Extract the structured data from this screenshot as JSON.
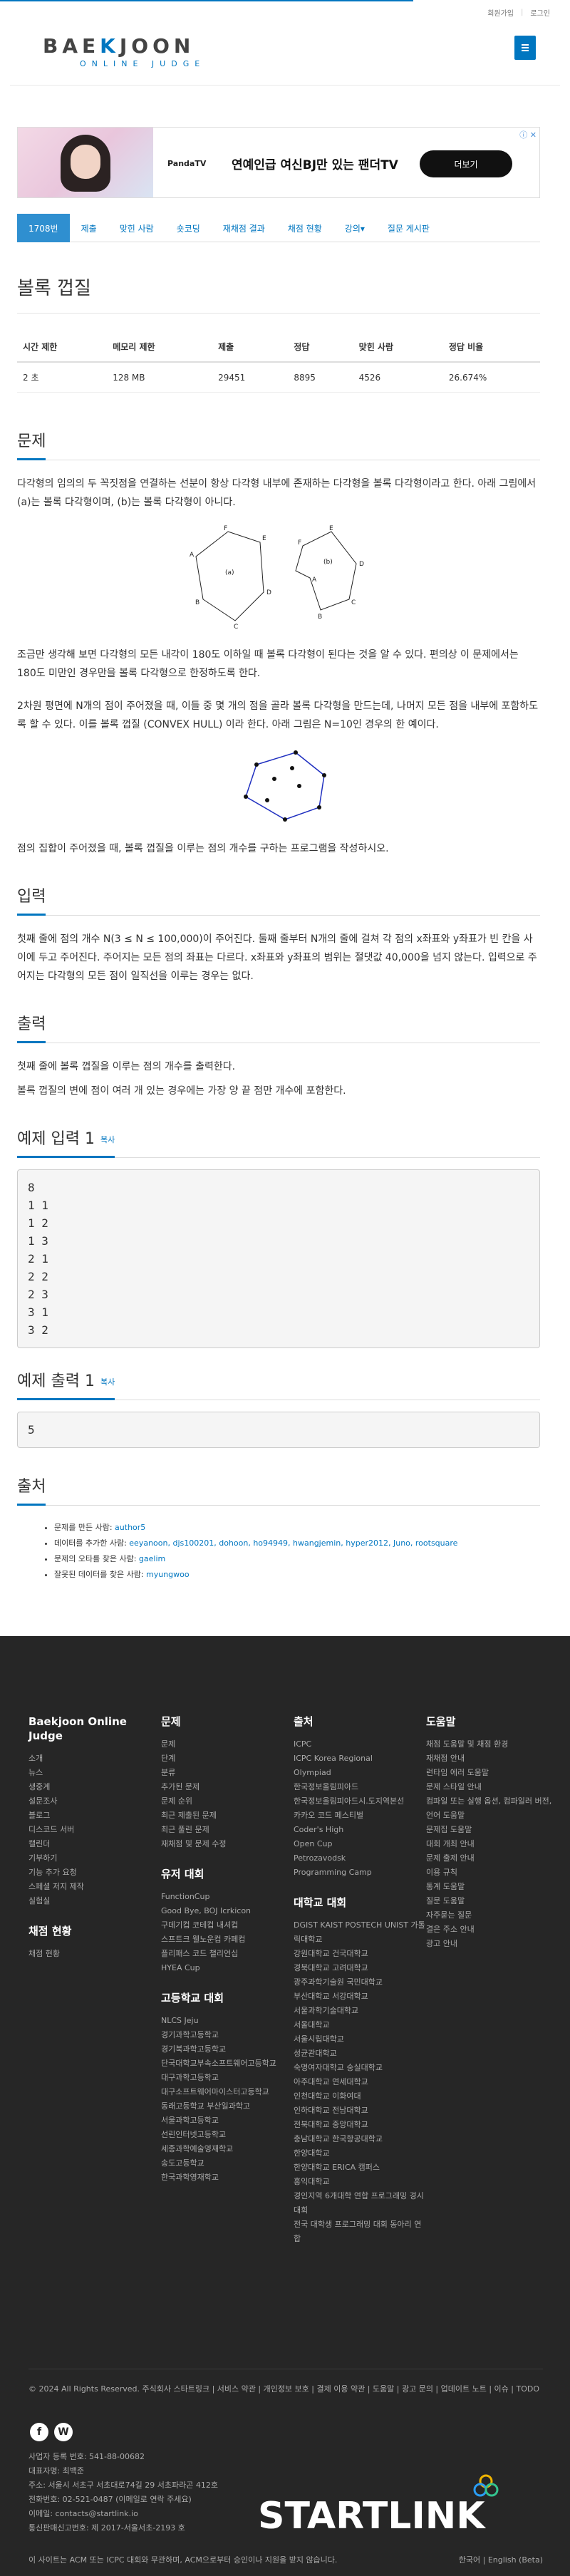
{
  "toplinks": {
    "signup": "회원가입",
    "login": "로그인"
  },
  "logo": {
    "main_a": "BAE",
    "main_k": "K",
    "main_b": "JOON",
    "sub": "ONLINE JUDGE"
  },
  "ad": {
    "brand": "PandaTV",
    "text": "연예인급 여신BJ만 있는 팬더TV",
    "button": "더보기"
  },
  "tabs": [
    "1708번",
    "제출",
    "맞힌 사람",
    "숏코딩",
    "재채점 결과",
    "채점 현황",
    "강의▾",
    "질문 게시판"
  ],
  "title": "볼록 껍질",
  "info": {
    "headers": [
      "시간 제한",
      "메모리 제한",
      "제출",
      "정답",
      "맞힌 사람",
      "정답 비율"
    ],
    "values": [
      "2 초",
      "128 MB",
      "29451",
      "8895",
      "4526",
      "26.674%"
    ]
  },
  "sections": {
    "problem": "문제",
    "input": "입력",
    "output": "출력",
    "sample_in": "예제 입력 1",
    "sample_out": "예제 출력 1",
    "source": "출처",
    "copy": "복사"
  },
  "problem_text": [
    "다각형의 임의의 두 꼭짓점을 연결하는 선분이 항상 다각형 내부에 존재하는 다각형을 볼록 다각형이라고 한다. 아래 그림에서 (a)는 볼록 다각형이며, (b)는 볼록 다각형이 아니다.",
    "조금만 생각해 보면 다각형의 모든 내각이 180도 이하일 때 볼록 다각형이 된다는 것을 알 수 있다. 편의상 이 문제에서는 180도 미만인 경우만을 볼록 다각형으로 한정하도록 한다.",
    "2차원 평면에 N개의 점이 주어졌을 때, 이들 중 몇 개의 점을 골라 볼록 다각형을 만드는데, 나머지 모든 점을 내부에 포함하도록 할 수 있다. 이를 볼록 껍질 (CONVEX HULL) 이라 한다. 아래 그림은 N=10인 경우의 한 예이다.",
    "점의 집합이 주어졌을 때, 볼록 껍질을 이루는 점의 개수를 구하는 프로그램을 작성하시오."
  ],
  "fig1_labels": [
    "A",
    "B",
    "C",
    "D",
    "E",
    "F",
    "(a)",
    "A",
    "B",
    "C",
    "D",
    "E",
    "F",
    "(b)"
  ],
  "input_text": "첫째 줄에 점의 개수 N(3 ≤ N ≤ 100,000)이 주어진다. 둘째 줄부터 N개의 줄에 걸쳐 각 점의 x좌표와 y좌표가 빈 칸을 사이에 두고 주어진다. 주어지는 모든 점의 좌표는 다르다. x좌표와 y좌표의 범위는 절댓값 40,000을 넘지 않는다. 입력으로 주어지는 다각형의 모든 점이 일직선을 이루는 경우는 없다.",
  "output_text": [
    "첫째 줄에 볼록 껍질을 이루는 점의 개수를 출력한다.",
    "볼록 껍질의 변에 점이 여러 개 있는 경우에는 가장 양 끝 점만 개수에 포함한다."
  ],
  "sample_in": "8\n1 1\n1 2\n1 3\n2 1\n2 2\n2 3\n3 1\n3 2",
  "sample_out": "5",
  "source": [
    {
      "label": "문제를 만든 사람: ",
      "value": "author5"
    },
    {
      "label": "데이터를 추가한 사람: ",
      "value": "eeyanoon, djs100201, dohoon, ho94949, hwangjemin, hyper2012, Juno, rootsquare"
    },
    {
      "label": "문제의 오타를 찾은 사람: ",
      "value": "gaelim"
    },
    {
      "label": "잘못된 데이터를 찾은 사람: ",
      "value": "myungwoo"
    }
  ],
  "footer": {
    "col1": {
      "title": "Baekjoon Online Judge",
      "links": [
        "소개",
        "뉴스",
        "생중계",
        "설문조사",
        "블로그",
        "디스코드 서버",
        "캘린더",
        "기부하기",
        "기능 추가 요청",
        "스페셜 저지 제작",
        "실험실"
      ],
      "title2": "채점 현황",
      "links2": [
        "채점 현황"
      ]
    },
    "col2": {
      "title": "문제",
      "links": [
        "문제",
        "단계",
        "분류",
        "추가된 문제",
        "문제 순위",
        "최근 제출된 문제",
        "최근 풀린 문제",
        "재채점 및 문제 수정"
      ],
      "title2": "유저 대회",
      "links2": [
        "FunctionCup",
        "Good Bye, BOJ Icrkicon",
        "구데기컵 코테컵 내셔컵",
        "스프트크 웰노운컵 카페컵",
        "플리패스 코드 챌리언십",
        "HYEA Cup"
      ],
      "title3": "고등학교 대회",
      "links3": [
        "NLCS Jeju",
        "경기과학고등학교",
        "경기북과학고등학교",
        "단국대학교부속소프트웨어고등학교",
        "대구과학고등학교",
        "대구소프트웨어마이스터고등학교",
        "동래고등학교 부산일과학고",
        "서울과학고등학교",
        "선린인터넷고등학교",
        "세종과학예술영재학교",
        "송도고등학교",
        "한국과학영재학교"
      ]
    },
    "col3": {
      "title": "출처",
      "links": [
        "ICPC",
        "ICPC Korea Regional",
        "Olympiad",
        "한국정보올림피아드",
        "한국정보올림피아드시.도지역본선",
        "카카오 코드 페스티벌",
        "Coder's High",
        "Open Cup",
        "Petrozavodsk",
        "Programming Camp"
      ],
      "title2": "대학교 대회",
      "links2": [
        "DGIST KAIST POSTECH UNIST 가톨릭대학교",
        "강원대학교 건국대학교",
        "경북대학교 고려대학교",
        "광주과학기술원 국민대학교",
        "부산대학교 서강대학교",
        "서울과학기술대학교",
        "서울대학교",
        "서울시립대학교",
        "성균관대학교",
        "숙명여자대학교 숭실대학교",
        "아주대학교 연세대학교",
        "인천대학교 이화여대",
        "인하대학교 전남대학교",
        "전북대학교 중앙대학교",
        "충남대학교 한국항공대학교",
        "한양대학교",
        "한양대학교 ERICA 캠퍼스",
        "홍익대학교",
        "경인지역 6개대학 연합 프로그래밍 경시대회",
        "전국 대학생 프로그래밍 대회 동아리 연합"
      ]
    },
    "col4": {
      "title": "도움말",
      "links": [
        "채점 도움말 및 채점 환경",
        "재채점 안내",
        "런타임 에러 도움말",
        "문제 스타일 안내",
        "컴파일 또는 실행 옵션, 컴파일러 버전, 언어 도움말",
        "문제집 도움말",
        "대회 개최 안내",
        "문제 출제 안내",
        "이용 규칙",
        "통계 도움말",
        "질문 도움말",
        "자주묻는 질문",
        "결은 주소 안내",
        "광고 안내"
      ]
    },
    "bottom": "© 2024 All Rights Reserved. 주식회사 스타트링크 | 서비스 약관 | 개인정보 보호 | 결제 이용 약관 | 도움말 | 광고 문의 | 업데이트 노트 | 이슈 | TODO",
    "company": [
      "사업자 등록 번호: 541-88-00682",
      "대표자명: 최백준",
      "주소: 서울시 서초구 서초대로74길 29 서초파라곤 412호",
      "전화번호: 02-521-0487 (이메일로 연락 주세요)",
      "이메일: contacts@startlink.io",
      "통신판매신고번호: 제 2017-서울서초-2193 호"
    ],
    "note": "이 사이트는 ACM 또는 ICPC 대회와 무관하며, ACM으로부터 승인이나 지원을 받지 않습니다.",
    "lang": "한국어 | English (Beta)",
    "startlink": "STARTLINK"
  },
  "colors": {
    "accent": "#0076c0",
    "footer_bg": "#262626"
  }
}
